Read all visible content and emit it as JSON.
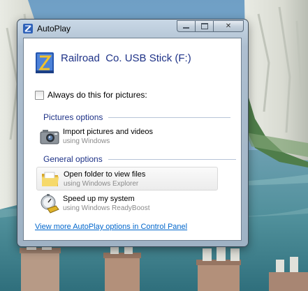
{
  "window": {
    "title": "AutoPlay",
    "icon": "autoplay-icon",
    "controls": {
      "minimize_icon": "minimize-icon",
      "maximize_icon": "maximize-icon",
      "close_icon": "close-icon",
      "close_glyph": "✕"
    }
  },
  "device": {
    "name": "Railroad  Co. USB Stick (F:)",
    "icon": "usb-drive-icon"
  },
  "always_checkbox": {
    "label": "Always do this for pictures:",
    "checked": false
  },
  "pictures_section": {
    "heading": "Pictures options",
    "options": [
      {
        "label": "Import pictures and videos",
        "sublabel": "using Windows",
        "icon": "camera-icon"
      }
    ]
  },
  "general_section": {
    "heading": "General options",
    "options": [
      {
        "label": "Open folder to view files",
        "sublabel": "using Windows Explorer",
        "icon": "folder-icon"
      },
      {
        "label": "Speed up my system",
        "sublabel": "using Windows ReadyBoost",
        "icon": "readyboost-icon"
      }
    ]
  },
  "more_link": "View more AutoPlay options in Control Panel",
  "colors": {
    "heading_blue": "#1e3287",
    "link_blue": "#0066cc"
  }
}
